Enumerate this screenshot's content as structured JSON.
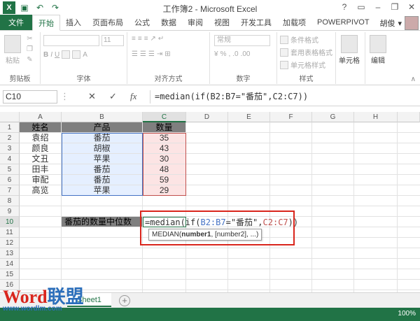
{
  "titlebar": {
    "title": "工作簿2 - Microsoft Excel",
    "logo": "X"
  },
  "tabs": {
    "file": "文件",
    "items": [
      "开始",
      "插入",
      "页面布局",
      "公式",
      "数据",
      "审阅",
      "视图",
      "开发工具",
      "加载项",
      "POWERPIVOT"
    ],
    "user": "胡俊"
  },
  "ribbon": {
    "clipboard": {
      "paste": "粘贴",
      "label": "剪贴板"
    },
    "font": {
      "size": "11",
      "label": "字体"
    },
    "alignment": {
      "label": "对齐方式"
    },
    "number": {
      "format": "常规",
      "label": "数字"
    },
    "styles": {
      "conditional": "条件格式",
      "table": "套用表格格式",
      "cell": "单元格样式",
      "label": "样式"
    },
    "cells": {
      "label": "单元格"
    },
    "editing": {
      "label": "编辑"
    }
  },
  "formula_bar": {
    "name_box": "C10",
    "fx": "fx",
    "formula": "=median(if(B2:B7=\"番茄\",C2:C7))"
  },
  "columns": [
    "A",
    "B",
    "C",
    "D",
    "E",
    "F",
    "G",
    "H"
  ],
  "rows": [
    "1",
    "2",
    "3",
    "4",
    "5",
    "6",
    "7",
    "8",
    "9",
    "10",
    "11",
    "12",
    "13",
    "14",
    "15",
    "16"
  ],
  "table": {
    "headers": [
      "姓名",
      "产品",
      "数量"
    ],
    "rows": [
      [
        "袁绍",
        "番茄",
        "35"
      ],
      [
        "颜良",
        "胡椒",
        "43"
      ],
      [
        "文丑",
        "苹果",
        "30"
      ],
      [
        "田丰",
        "番茄",
        "48"
      ],
      [
        "审配",
        "番茄",
        "59"
      ],
      [
        "高览",
        "苹果",
        "29"
      ]
    ]
  },
  "edit": {
    "label": "番茄的数量中位数",
    "prefix": "=median(if(",
    "ref1": "B2:B7",
    "mid": "=\"番茄\",",
    "ref2": "C2:C7",
    "suffix": "))"
  },
  "tooltip": {
    "fn": "MEDIAN(",
    "arg1": "number1",
    "rest": ", [number2], ...)"
  },
  "sheet": {
    "tab": "Sheet1",
    "add": "+"
  },
  "status": {
    "zoom": "100%"
  },
  "watermark": {
    "word_a": "Word",
    "word_b": "联盟",
    "url": "www.wordlm.com"
  },
  "colors": {
    "accent": "#217346",
    "ref_blue": "#4472c4",
    "ref_red": "#c0504d",
    "highlight": "#d9251c"
  }
}
